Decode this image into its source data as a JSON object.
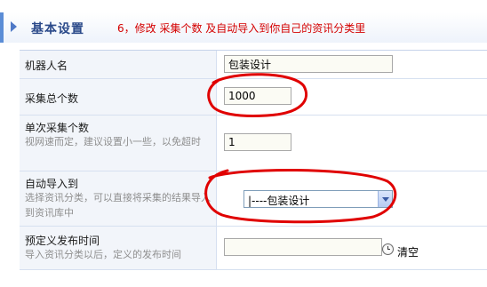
{
  "header": {
    "title": "基本设置",
    "note": "6，修改 采集个数 及自动导入到你自己的资讯分类里"
  },
  "form": {
    "rows": [
      {
        "label": "机器人名",
        "value": "包装设计"
      },
      {
        "label": "采集总个数",
        "value": "1000"
      },
      {
        "label": "单次采集个数",
        "hint": "视网速而定，建议设置小一些，以免超时",
        "value": "1"
      },
      {
        "label": "自动导入到",
        "hint": "选择资讯分类，可以直接将采集的结果导入到资讯库中",
        "value": "|----包装设计"
      },
      {
        "label": "预定义发布时间",
        "hint": "导入资讯分类以后，定义的发布时间",
        "value": "",
        "clear_label": "清空"
      }
    ]
  },
  "icons": {
    "time_picker": "clock-icon",
    "dropdown": "chevron-down-icon",
    "header_marker": "triangle-right-icon"
  },
  "colors": {
    "annotation": "#d40000",
    "header_accent": "#5b8dd6",
    "label_bg": "#f2f5fa"
  }
}
